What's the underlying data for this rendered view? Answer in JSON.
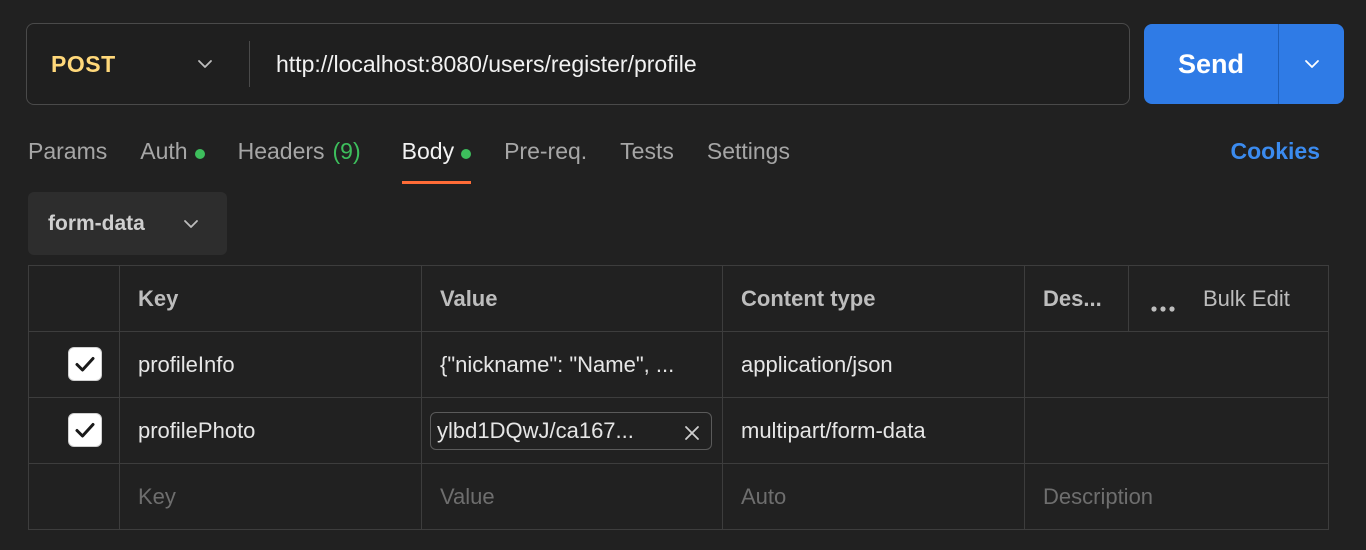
{
  "request": {
    "method": "POST",
    "url": "http://localhost:8080/users/register/profile"
  },
  "send": {
    "label": "Send"
  },
  "tabs": [
    {
      "label": "Params"
    },
    {
      "label": "Auth"
    },
    {
      "label": "Headers",
      "count": "(9)"
    },
    {
      "label": "Body"
    },
    {
      "label": "Pre-req."
    },
    {
      "label": "Tests"
    },
    {
      "label": "Settings"
    }
  ],
  "cookies_label": "Cookies",
  "body_type": "form-data",
  "table": {
    "headers": {
      "key": "Key",
      "value": "Value",
      "content_type": "Content type",
      "description": "Des...",
      "bulk_edit": "Bulk Edit"
    },
    "rows": [
      {
        "key": "profileInfo",
        "value": "{\"nickname\": \"Name\", ...",
        "content_type": "application/json"
      },
      {
        "key": "profilePhoto",
        "value": "ylbd1DQwJ/ca167...",
        "content_type": "multipart/form-data"
      }
    ],
    "placeholders": {
      "key": "Key",
      "value": "Value",
      "content_type": "Auto",
      "description": "Description"
    }
  },
  "colors": {
    "background": "#212121",
    "accent_blue": "#2f7be6",
    "method_yellow": "#ffd87a",
    "active_tab_underline": "#ff6c37",
    "status_green": "#3dbe5c",
    "cookies_blue": "#3b8bef"
  },
  "icons": {
    "method_dropdown": "chevron-down-icon",
    "send_dropdown": "chevron-down-icon",
    "body_type_dropdown": "chevron-down-icon",
    "checkbox": "checkmark-icon",
    "file_remove": "close-icon",
    "more": "more-horizontal-icon"
  }
}
